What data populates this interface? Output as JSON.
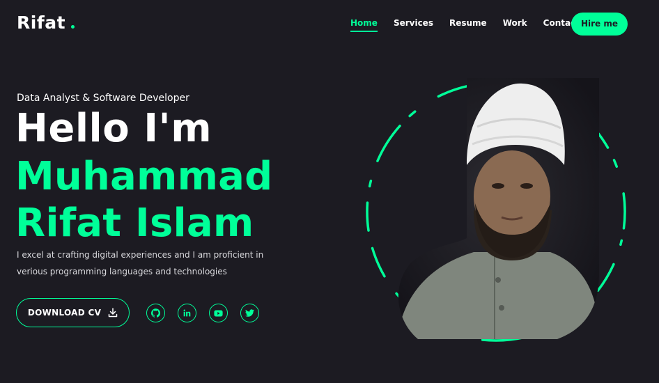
{
  "header": {
    "logo": "Rifat",
    "nav": [
      {
        "label": "Home",
        "active": true
      },
      {
        "label": "Services",
        "active": false
      },
      {
        "label": "Resume",
        "active": false
      },
      {
        "label": "Work",
        "active": false
      },
      {
        "label": "Contact",
        "active": false
      }
    ],
    "hire_label": "Hire me"
  },
  "hero": {
    "subtitle": "Data Analyst & Software Developer",
    "greeting": "Hello I'm",
    "name": "Muhammad Rifat Islam",
    "description": "I excel at crafting digital experiences and I am proficient in verious programming languages and technologies",
    "cv_label": "DOWNLOAD CV",
    "cv_icon": "download-icon",
    "socials": [
      "github-icon",
      "linkedin-icon",
      "youtube-icon",
      "twitter-icon"
    ]
  },
  "colors": {
    "accent": "#00ff99",
    "background": "#1c1b22"
  }
}
